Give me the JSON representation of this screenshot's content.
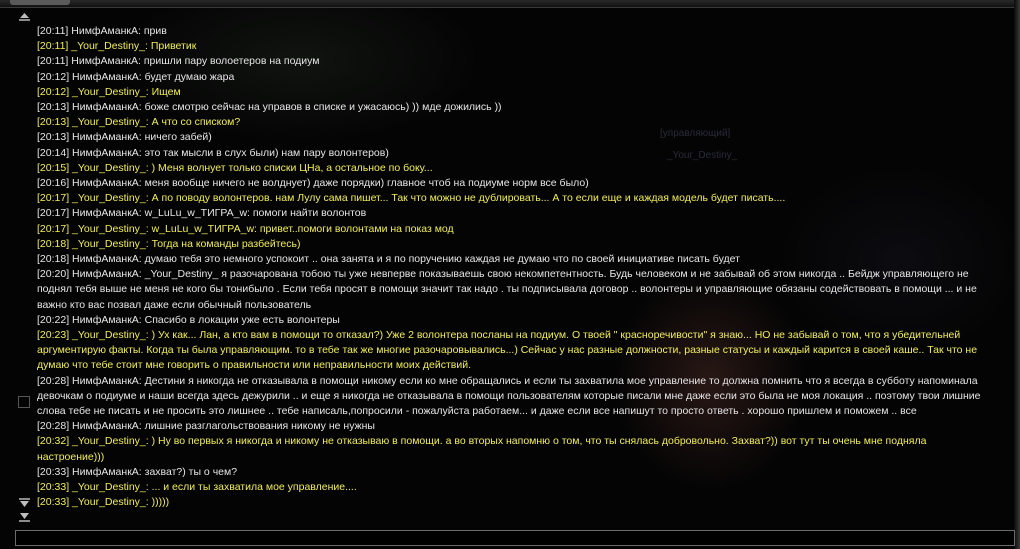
{
  "background": {
    "ghost_role": "[управляющий]",
    "ghost_name": "_Your_Destiny_"
  },
  "colors": {
    "normal_text": "#e6e6e6",
    "highlight_text": "#f2ee55",
    "background": "#040404"
  },
  "icons": {
    "scroll_up": "arrow-up-icon",
    "scroll_down": "arrow-down-icon",
    "scroll_bottom": "arrow-to-bottom-icon"
  },
  "chat": {
    "messages": [
      {
        "text": "[20:11] НимфАманкА: прив",
        "highlight": false
      },
      {
        "text": "[20:11] _Your_Destiny_: Приветик",
        "highlight": true
      },
      {
        "text": "[20:11] НимфАманкА: пришли пару волоетеров на подиум",
        "highlight": false
      },
      {
        "text": "[20:12] НимфАманкА: будет думаю жара",
        "highlight": false
      },
      {
        "text": "[20:12] _Your_Destiny_: Ищем",
        "highlight": true
      },
      {
        "text": "[20:13] НимфАманкА: боже смотрю сейчас на управов в списке и ужасаюсь) )) мде дожились ))",
        "highlight": false
      },
      {
        "text": "[20:13] _Your_Destiny_: А что со списком?",
        "highlight": true
      },
      {
        "text": "[20:13] НимфАманкА: ничего забей)",
        "highlight": false
      },
      {
        "text": "[20:14] НимфАманкА: это так мысли в слух были) нам пару волонтеров)",
        "highlight": false
      },
      {
        "text": "[20:15] _Your_Destiny_: ) Меня волнует только списки ЦНа, а остальное по боку...",
        "highlight": true
      },
      {
        "text": "[20:16] НимфАманкА: меня вообще ничего не волднует) даже порядки) главное чтоб на подиуме норм все было)",
        "highlight": false
      },
      {
        "text": "[20:17] _Your_Destiny_: А по поводу волонтеров. нам Лулу сама пишет... Так что можно не дублировать... А то если еще и каждая модель будет писать....",
        "highlight": true
      },
      {
        "text": "[20:17] НимфАманкА: w_LuLu_w_ТИГРА_w: помоги найти волонтов",
        "highlight": false
      },
      {
        "text": "[20:17] _Your_Destiny_: w_LuLu_w_ТИГРА_w: привет..помоги волонтами на показ мод",
        "highlight": true
      },
      {
        "text": "[20:18] _Your_Destiny_: Тогда на команды разбейтесь)",
        "highlight": true
      },
      {
        "text": "[20:18] НимфАманкА: думаю тебя это немного успокоит .. она занята и я по поручению каждая не думаю что по своей инициативе писать будет",
        "highlight": false
      },
      {
        "text": "[20:20] НимфАманкА: _Your_Destiny_ я разочарована тобою ты уже невперве показываешь свою некомпетентность. Будь человеком и не забывай об этом никогда .. Бейдж управляющего не поднял тебя выше не меня не кого бы тонибыло . Если тебя просят в помощи  значит так надо . ты подписывала договор .. волонтеры и управляющие обязаны содействовать в помощи ... и не важно кто вас позвал даже если обычный пользователь",
        "highlight": false
      },
      {
        "text": "[20:22] НимфАманкА: Спасибо в локации уже есть волонтеры",
        "highlight": false
      },
      {
        "text": "[20:23] _Your_Destiny_: ) Ух как... Лан, а кто вам в помощи то отказал?) Уже 2 волонтера посланы на подиум. О твоей \" красноречивости\" я знаю... НО не забывай о том, что я убедительней аргументирую факты. Когда ты была управляющим. то в тебе так же многие разочаровывались...) Сейчас у нас разные должности, разные статусы и каждый карится в своей каше.. Так что не думаю что тебе стоит мне говорить о правильности или неправильности моих действий.",
        "highlight": true
      },
      {
        "text": "[20:28] НимфАманкА: Дестини я никогда не отказывала в помощи никому если ко мне обращались и если ты захватила   мое управление то должна помнить что я всегда в субботу напоминала девочкам о подиуме и наши всегда здесь дежурили .. и еще я никогда не отказывала в помощи пользователям которые писали мне даже если это была не моя локация .. поэтому твои лишние слова тебе не писать и не просить это лишнее .. тебе написаль,попросили - пожалуйста работаем...  и даже если все напишут то просто ответь . хорошо пришлем и поможем .. все",
        "highlight": false
      },
      {
        "text": "[20:28] НимфАманкА: лишние разглагольствования никому не нужны",
        "highlight": false
      },
      {
        "text": "[20:32] _Your_Destiny_: ) Ну во первых я никогда и никому не отказываю в помощи. а во вторых напомню о том, что ты снялась добровольно. Захват?)) вот тут ты очень мне подняла настроение)))",
        "highlight": true
      },
      {
        "text": "[20:33] НимфАманкА: захват?) ты о чем?",
        "highlight": false
      },
      {
        "text": "[20:33] _Your_Destiny_: ... и если ты захватила мое управление....",
        "highlight": true
      },
      {
        "text": "[20:33] _Your_Destiny_: )))))",
        "highlight": true
      }
    ],
    "input_value": ""
  }
}
